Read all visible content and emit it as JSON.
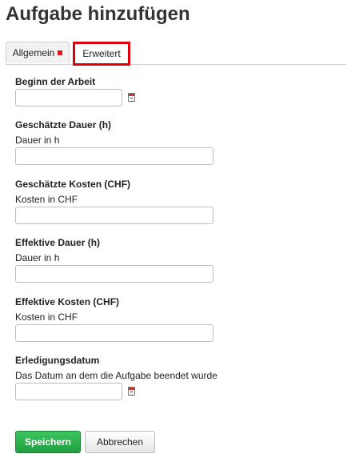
{
  "page": {
    "title": "Aufgabe hinzufügen"
  },
  "tabs": [
    {
      "label": "Allgemein",
      "has_error_marker": true,
      "active": false
    },
    {
      "label": "Erweitert",
      "active": true,
      "highlight_color": "#e0000d"
    }
  ],
  "form": {
    "beginn": {
      "label": "Beginn der Arbeit",
      "value": "",
      "icon": "calendar-icon"
    },
    "geschaetzte_dauer": {
      "label": "Geschätzte Dauer (h)",
      "hint": "Dauer in h",
      "value": ""
    },
    "geschaetzte_kosten": {
      "label": "Geschätzte Kosten (CHF)",
      "hint": "Kosten in CHF",
      "value": ""
    },
    "effektive_dauer": {
      "label": "Effektive Dauer (h)",
      "hint": "Dauer in h",
      "value": ""
    },
    "effektive_kosten": {
      "label": "Effektive Kosten (CHF)",
      "hint": "Kosten in CHF",
      "value": ""
    },
    "erledigungsdatum": {
      "label": "Erledigungsdatum",
      "hint": "Das Datum an dem die Aufgabe beendet wurde",
      "value": "",
      "icon": "calendar-icon"
    }
  },
  "buttons": {
    "save": "Speichern",
    "cancel": "Abbrechen"
  },
  "colors": {
    "save_button": "#27a745",
    "error_marker": "#e0141e"
  }
}
